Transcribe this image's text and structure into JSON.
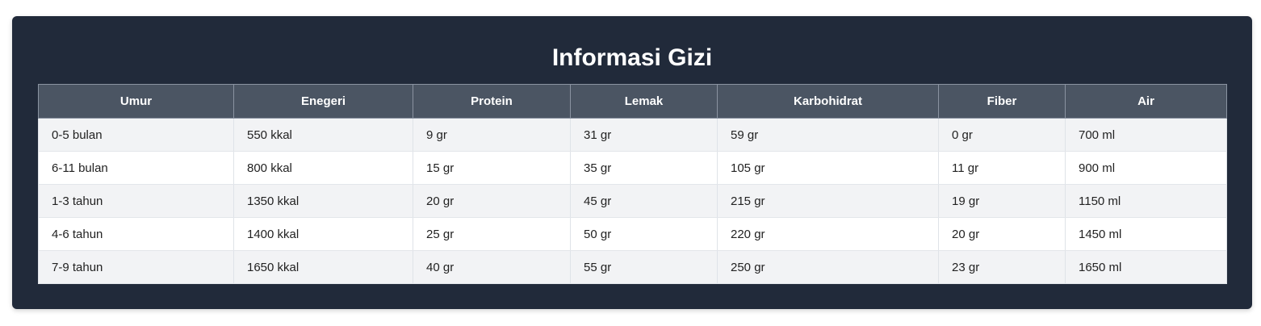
{
  "title": "Informasi Gizi",
  "table": {
    "headers": [
      "Umur",
      "Enegeri",
      "Protein",
      "Lemak",
      "Karbohidrat",
      "Fiber",
      "Air"
    ],
    "rows": [
      [
        "0-5 bulan",
        "550 kkal",
        "9 gr",
        "31 gr",
        "59 gr",
        "0 gr",
        "700 ml"
      ],
      [
        "6-11 bulan",
        "800 kkal",
        "15 gr",
        "35 gr",
        "105 gr",
        "11 gr",
        "900 ml"
      ],
      [
        "1-3 tahun",
        "1350 kkal",
        "20 gr",
        "45 gr",
        "215 gr",
        "19 gr",
        "1150 ml"
      ],
      [
        "4-6 tahun",
        "1400 kkal",
        "25 gr",
        "50 gr",
        "220 gr",
        "20 gr",
        "1450 ml"
      ],
      [
        "7-9 tahun",
        "1650 kkal",
        "40 gr",
        "55 gr",
        "250 gr",
        "23 gr",
        "1650 ml"
      ]
    ]
  },
  "colors": {
    "card_background": "#212a3a",
    "header_background": "#4b5563",
    "row_striped": "#f2f3f5"
  }
}
